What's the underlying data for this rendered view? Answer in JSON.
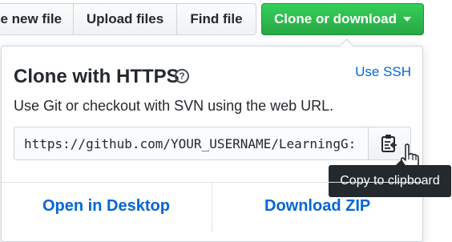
{
  "toolbar": {
    "create_label": "e new file",
    "upload_label": "Upload files",
    "find_label": "Find file",
    "clone_label": "Clone or download"
  },
  "clone_panel": {
    "title": "Clone with HTTPS",
    "use_ssh_label": "Use SSH",
    "description": "Use Git or checkout with SVN using the web URL.",
    "url_value": "https://github.com/YOUR_USERNAME/LearningG:",
    "copy_tooltip": "Copy to clipboard",
    "open_desktop_label": "Open in Desktop",
    "download_zip_label": "Download ZIP"
  },
  "icons": {
    "help": "question-circle-icon",
    "clipboard": "clipboard-icon",
    "cursor": "hand-pointer-icon",
    "caret": "caret-down-icon"
  },
  "colors": {
    "clone_button": "#2ea44f",
    "link": "#0366d6",
    "tooltip_bg": "#24292e"
  }
}
